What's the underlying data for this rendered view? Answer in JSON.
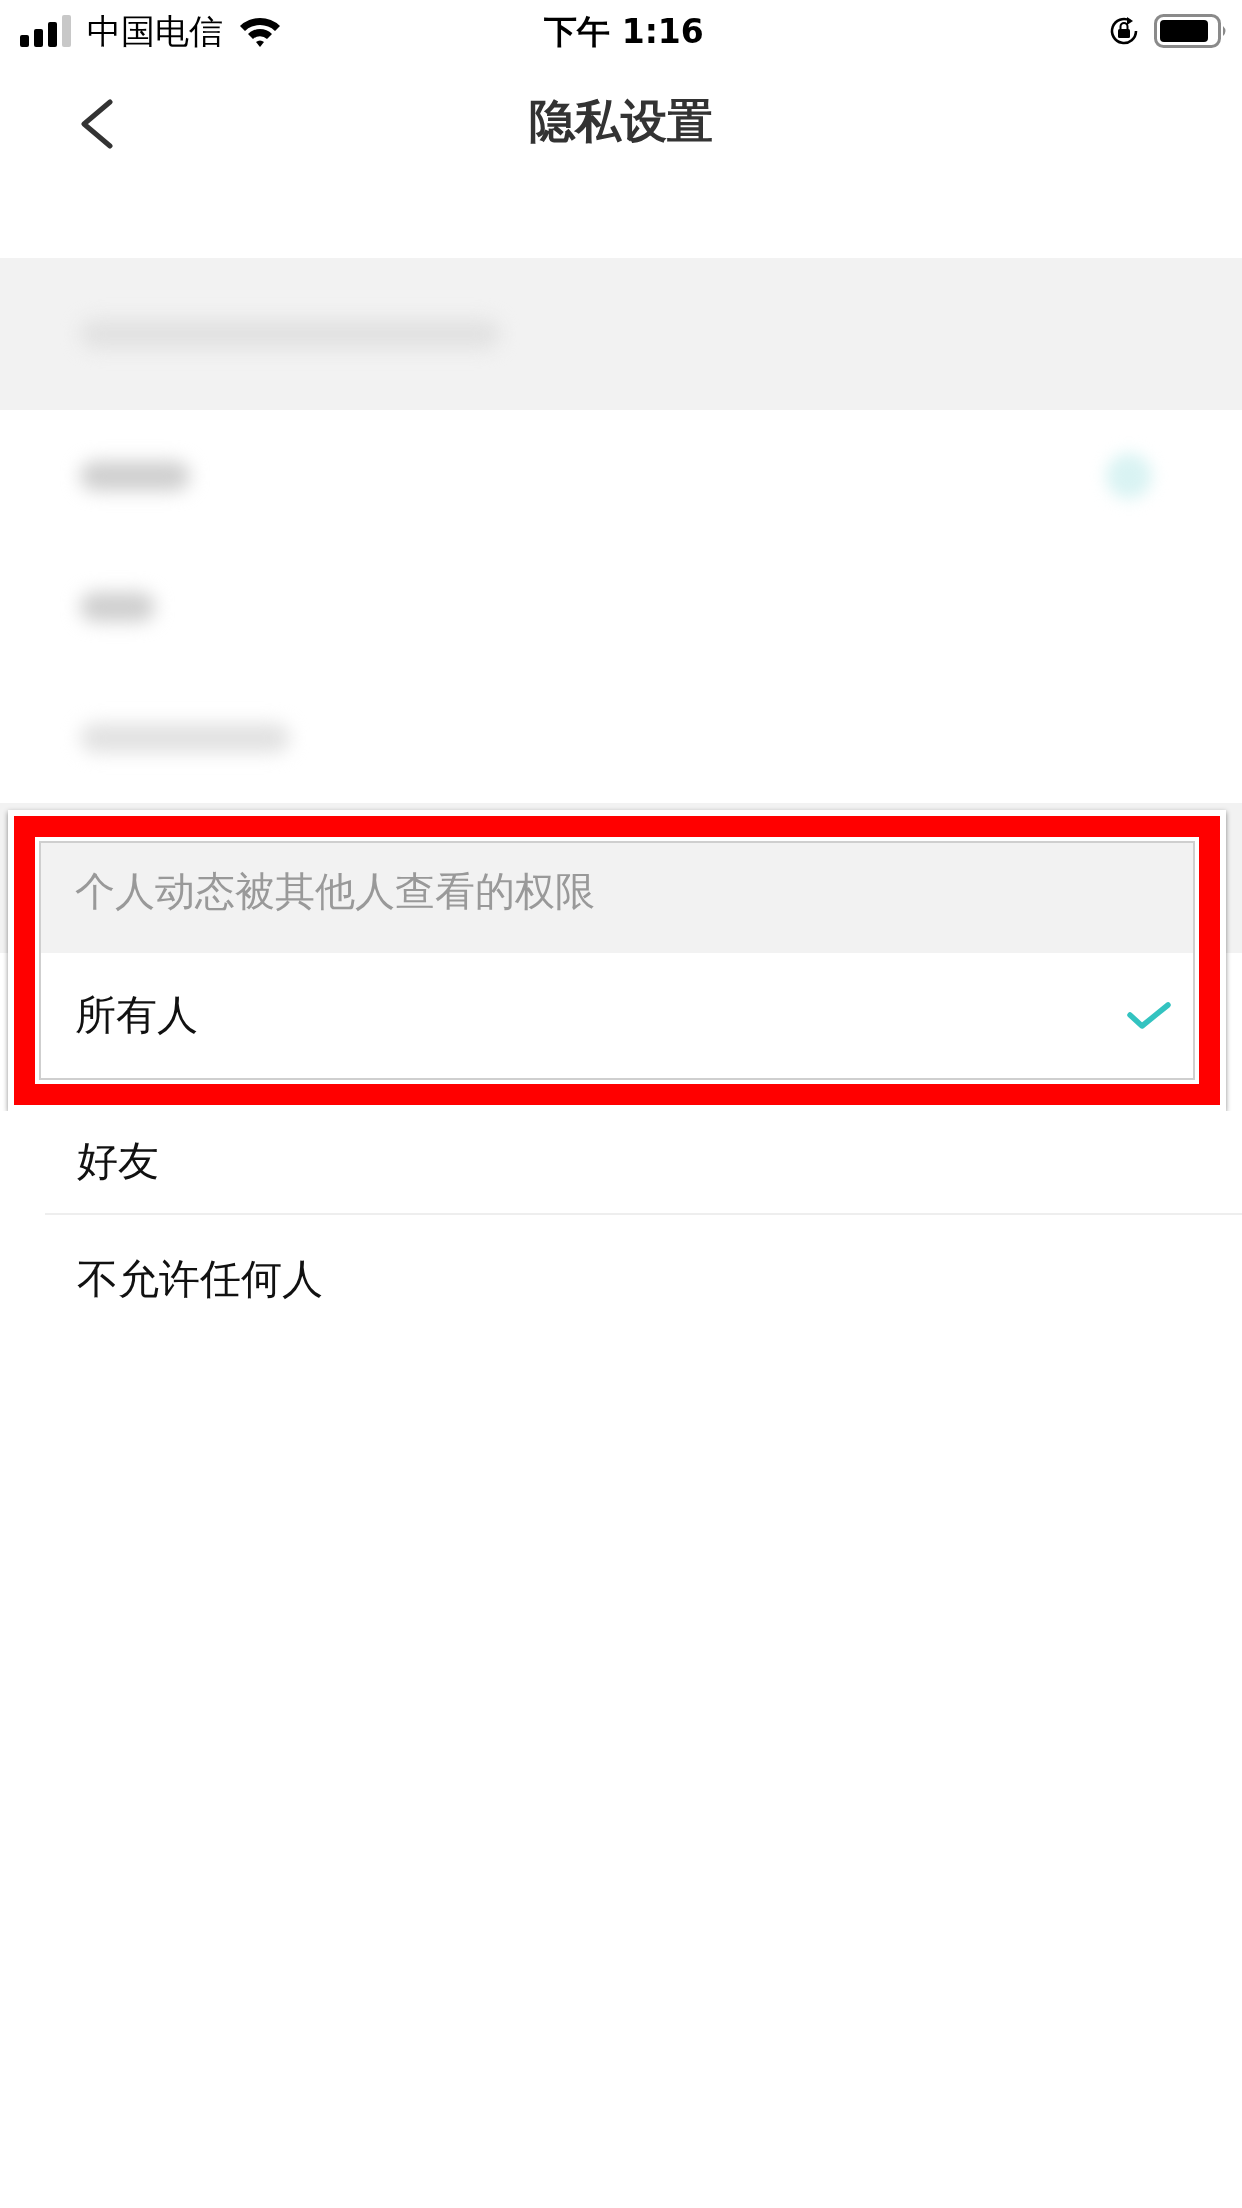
{
  "status_bar": {
    "carrier": "中国电信",
    "time": "下午 1:16"
  },
  "nav": {
    "title": "隐私设置"
  },
  "highlight": {
    "header": "个人动态被其他人查看的权限",
    "options": [
      {
        "label": "所有人",
        "selected": true
      }
    ]
  },
  "options": [
    {
      "label": "好友",
      "selected": false
    },
    {
      "label": "不允许任何人",
      "selected": false
    }
  ]
}
